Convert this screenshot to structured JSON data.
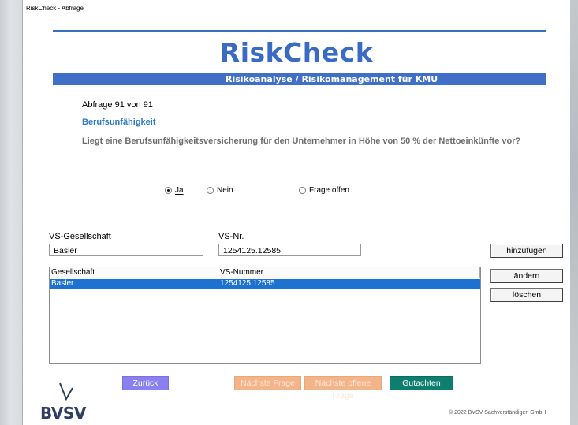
{
  "window": {
    "title": "RiskCheck - Abfrage"
  },
  "header": {
    "logo": "RiskCheck",
    "banner": "Risikoanalyse / Risikomanagement für KMU"
  },
  "question": {
    "counter": "Abfrage 91 von 91",
    "title": "Berufsunfähigkeit",
    "text": "Liegt eine Berufsunfähigkeitsversicherung für den Unternehmer in Höhe von 50 % der Nettoeinkünfte vor?"
  },
  "answers": {
    "options": [
      "Ja",
      "Nein",
      "Frage offen"
    ],
    "selected": "Ja"
  },
  "form": {
    "company_label": "VS-Gesellschaft",
    "company_value": "Basler",
    "number_label": "VS-Nr.",
    "number_value": "1254125.12585",
    "add_button": "hinzufügen",
    "edit_button": "ändern",
    "delete_button": "löschen"
  },
  "table": {
    "columns": [
      "Gesellschaft",
      "VS-Nummer"
    ],
    "rows": [
      {
        "company": "Basler",
        "number": "1254125.12585",
        "selected": true
      }
    ]
  },
  "nav": {
    "back": "Zurück",
    "next": "Nächste Frage",
    "next_open": "Nächste offene Frage",
    "report": "Gutachten"
  },
  "footer": {
    "brand": "BVSV",
    "copyright": "© 2022 BVSV Sachverständigen GmbH"
  },
  "colors": {
    "accent": "#3f6fc6",
    "selection": "#1d72d1",
    "back_button": "#8a80f0",
    "disabled_button": "#f4b48a",
    "report_button": "#0e7f6e"
  }
}
